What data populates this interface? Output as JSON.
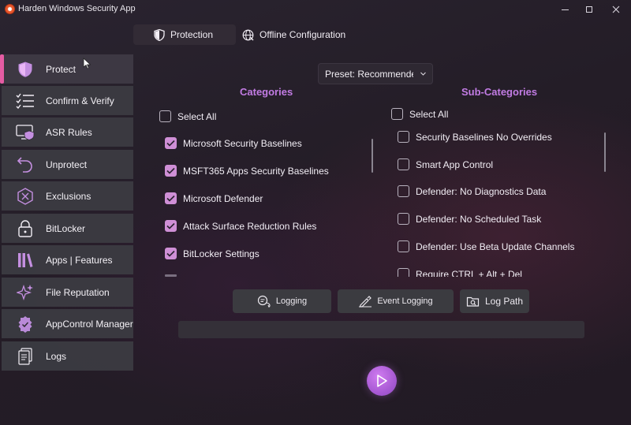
{
  "window": {
    "title": "Harden Windows Security App"
  },
  "tabs": [
    {
      "label": "Protection",
      "icon": "shield-icon",
      "active": true
    },
    {
      "label": "Offline Configuration",
      "icon": "globe-icon",
      "active": false
    }
  ],
  "sidebar": {
    "items": [
      {
        "label": "Protect",
        "icon": "shield-icon",
        "active": true
      },
      {
        "label": "Confirm & Verify",
        "icon": "checklist-icon"
      },
      {
        "label": "ASR Rules",
        "icon": "monitor-shield-icon"
      },
      {
        "label": "Unprotect",
        "icon": "undo-icon"
      },
      {
        "label": "Exclusions",
        "icon": "exclusion-icon"
      },
      {
        "label": "BitLocker",
        "icon": "lock-icon"
      },
      {
        "label": "Apps | Features",
        "icon": "library-icon"
      },
      {
        "label": "File Reputation",
        "icon": "sparkle-icon"
      },
      {
        "label": "AppControl Manager",
        "icon": "badge-icon"
      },
      {
        "label": "Logs",
        "icon": "document-icon"
      }
    ]
  },
  "preset": {
    "value": "Preset: Recommende"
  },
  "categories": {
    "heading": "Categories",
    "select_all": "Select All",
    "items": [
      {
        "label": "Microsoft Security Baselines",
        "checked": true
      },
      {
        "label": "MSFT365 Apps Security Baselines",
        "checked": true
      },
      {
        "label": "Microsoft Defender",
        "checked": true
      },
      {
        "label": "Attack Surface Reduction Rules",
        "checked": true
      },
      {
        "label": "BitLocker Settings",
        "checked": true
      }
    ]
  },
  "sub_categories": {
    "heading": "Sub-Categories",
    "select_all": "Select All",
    "items": [
      {
        "label": "Security Baselines No Overrides",
        "checked": false
      },
      {
        "label": "Smart App Control",
        "checked": false
      },
      {
        "label": "Defender: No Diagnostics Data",
        "checked": false
      },
      {
        "label": "Defender: No Scheduled Task",
        "checked": false
      },
      {
        "label": "Defender: Use Beta Update Channels",
        "checked": false
      },
      {
        "label": "Require CTRL + Alt + Del",
        "checked": false
      }
    ]
  },
  "actions": {
    "logging": "Logging",
    "event_logging": "Event Logging",
    "log_path": "Log Path"
  },
  "colors": {
    "accent": "#c27ce4",
    "active_indicator": "#e55ca3",
    "checkbox_checked": "#cf8fd6"
  }
}
